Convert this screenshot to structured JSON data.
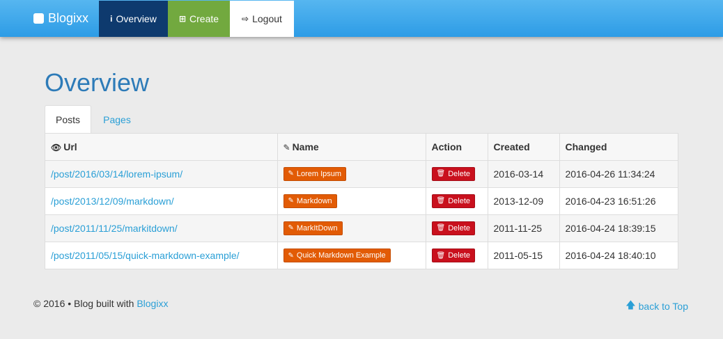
{
  "navbar": {
    "brand": "Blogixx",
    "items": [
      {
        "label": "Overview",
        "icon": "info-icon"
      },
      {
        "label": "Create",
        "icon": "plus-square-icon"
      },
      {
        "label": "Logout",
        "icon": "sign-out-icon"
      }
    ]
  },
  "page": {
    "title": "Overview"
  },
  "tabs": [
    {
      "label": "Posts",
      "active": true
    },
    {
      "label": "Pages",
      "active": false
    }
  ],
  "table": {
    "headers": [
      "Url",
      "Name",
      "Action",
      "Created",
      "Changed"
    ],
    "rows": [
      {
        "url": "/post/2016/03/14/lorem-ipsum/",
        "name": "Lorem Ipsum",
        "action": "Delete",
        "created": "2016-03-14",
        "changed": "2016-04-26 11:34:24"
      },
      {
        "url": "/post/2013/12/09/markdown/",
        "name": "Markdown",
        "action": "Delete",
        "created": "2013-12-09",
        "changed": "2016-04-23 16:51:26"
      },
      {
        "url": "/post/2011/11/25/markitdown/",
        "name": "MarkItDown",
        "action": "Delete",
        "created": "2011-11-25",
        "changed": "2016-04-24 18:39:15"
      },
      {
        "url": "/post/2011/05/15/quick-markdown-example/",
        "name": "Quick Markdown Example",
        "action": "Delete",
        "created": "2011-05-15",
        "changed": "2016-04-24 18:40:10"
      }
    ]
  },
  "footer": {
    "copyright": "© 2016 • Blog built with ",
    "link": "Blogixx",
    "back_to_top": "back to Top"
  },
  "colors": {
    "navbar": "#2d9ce6",
    "overview_active": "#0e3a6e",
    "create": "#72a93f",
    "name_button": "#e25b05",
    "delete_button": "#c9101d",
    "link": "#2a9fd6",
    "title": "#2d7bb8"
  }
}
